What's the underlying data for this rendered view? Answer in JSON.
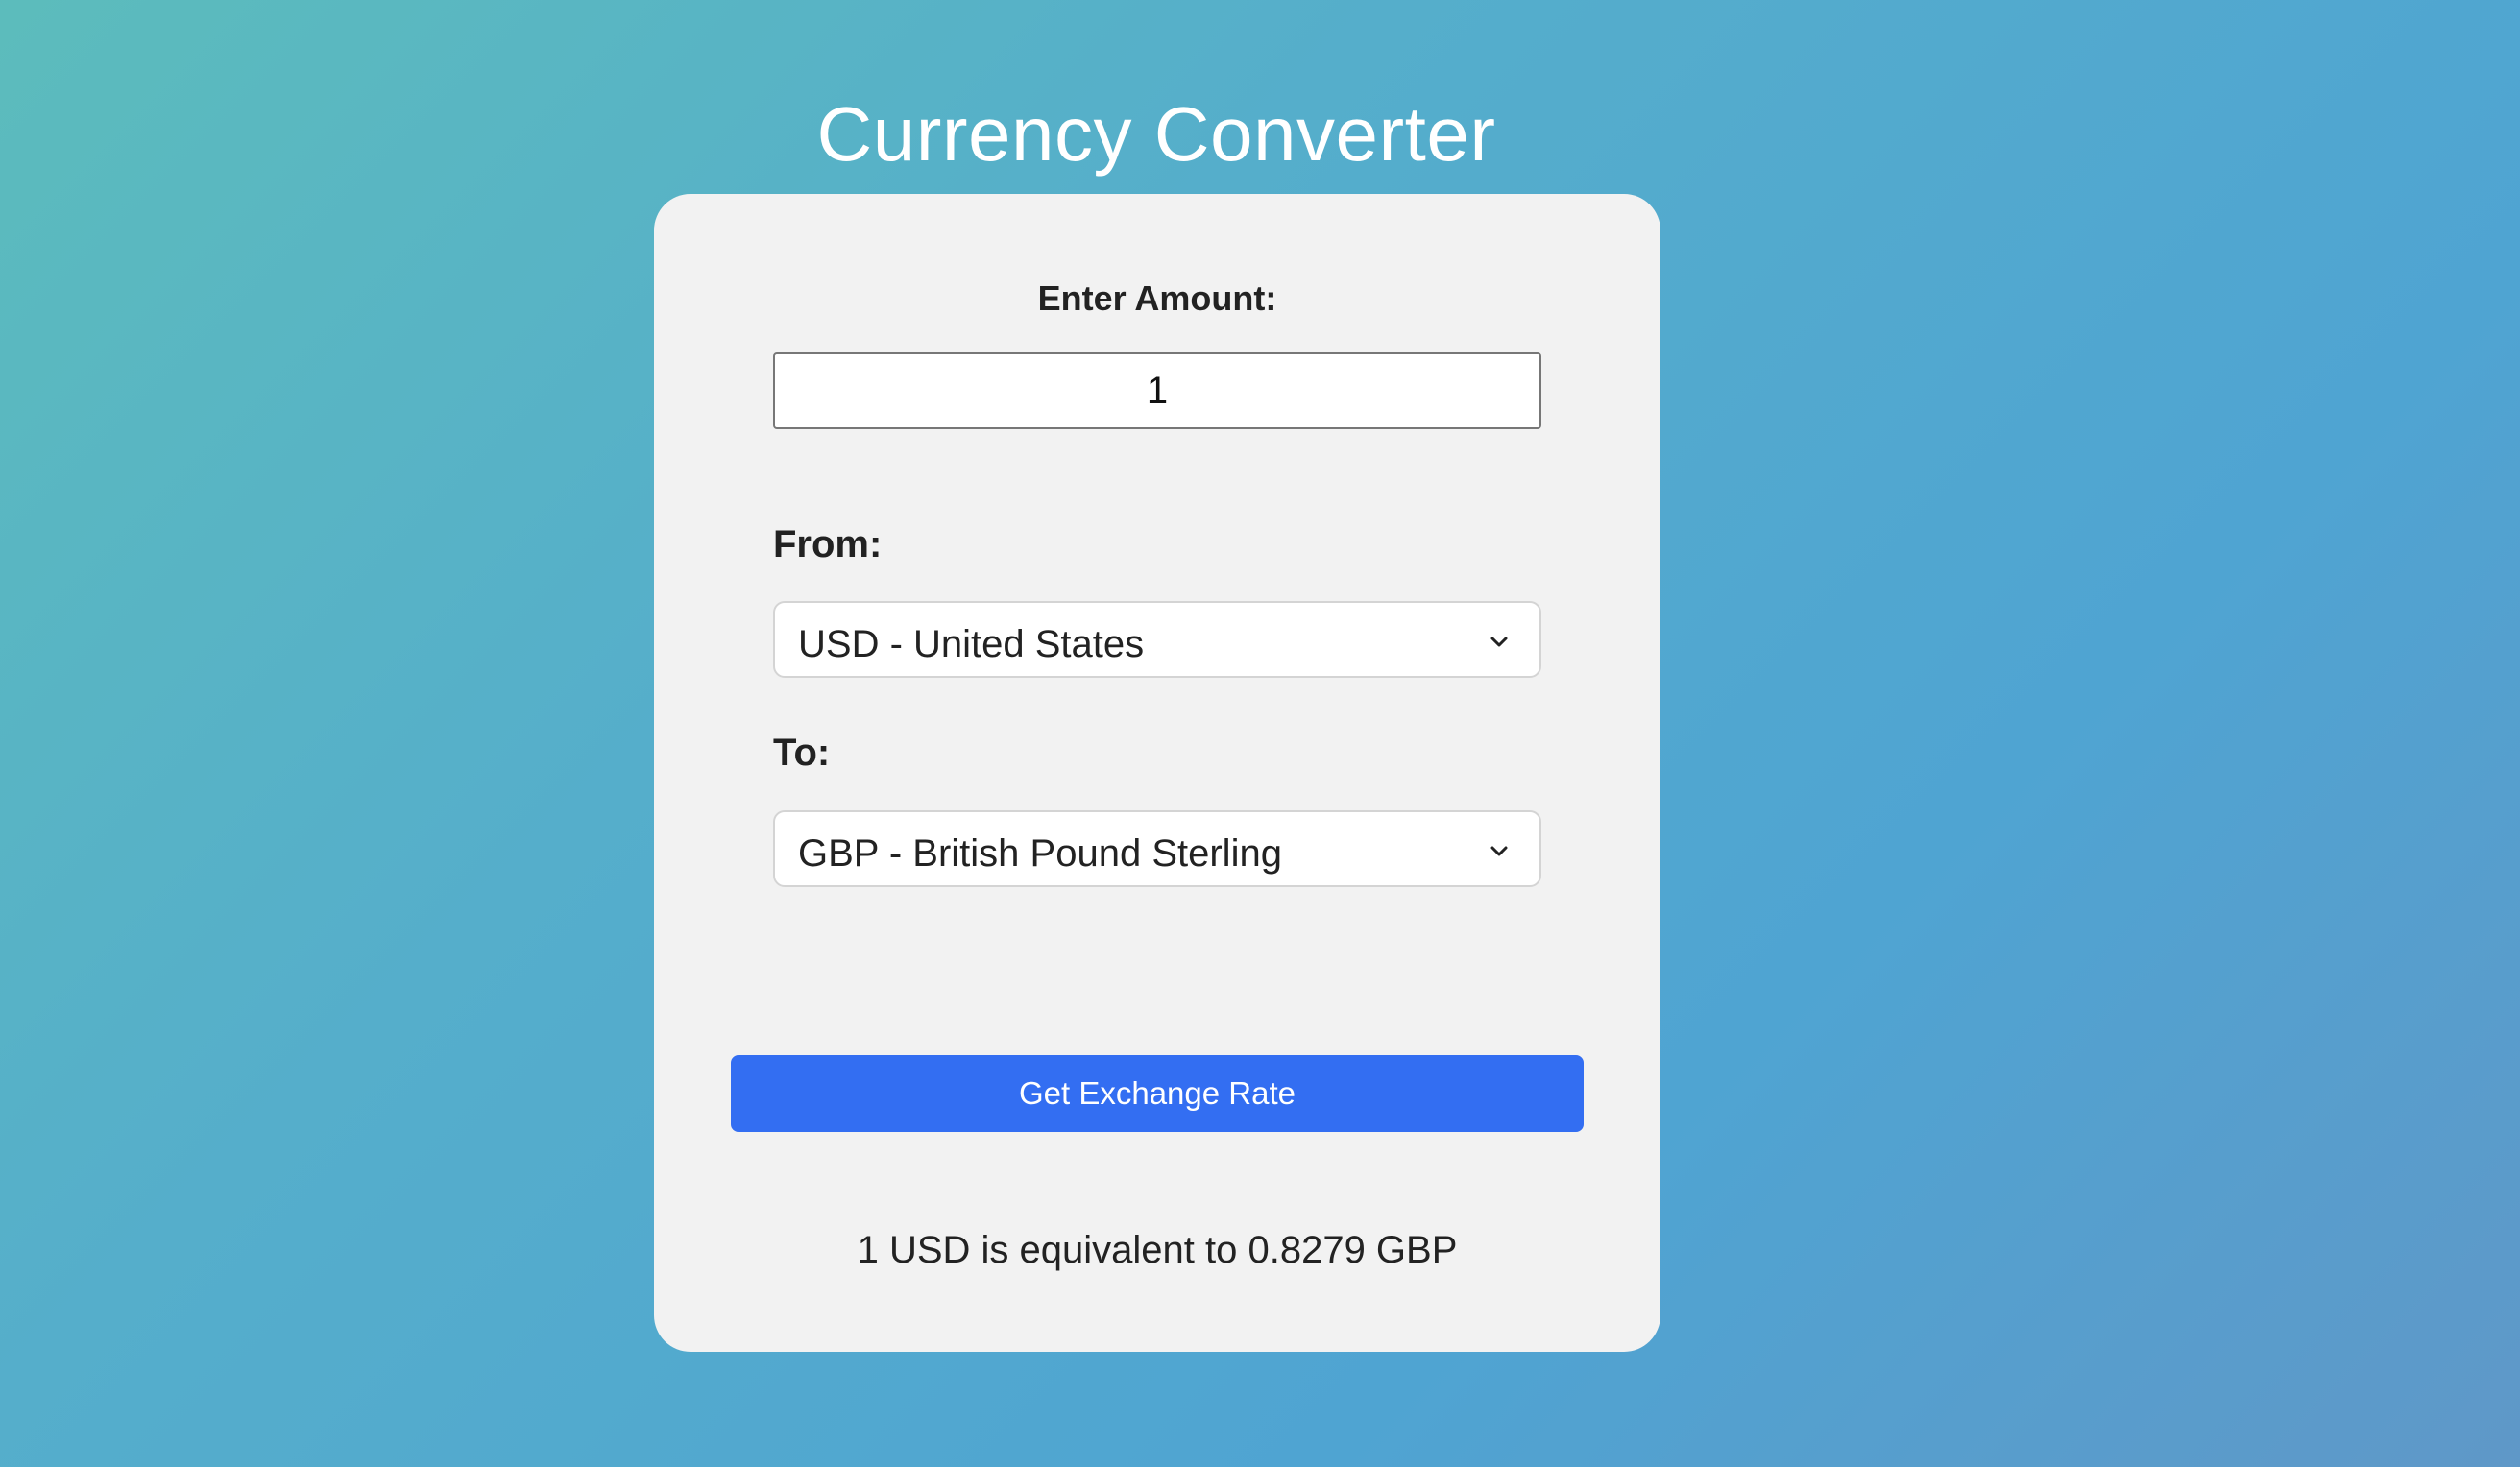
{
  "header": {
    "title": "Currency Converter"
  },
  "form": {
    "amount_label": "Enter Amount:",
    "amount_value": "1",
    "from_label": "From:",
    "from_selected": "USD - United States",
    "to_label": "To:",
    "to_selected": "GBP - British Pound Sterling",
    "button_label": "Get Exchange Rate"
  },
  "result": {
    "text": "1 USD is equivalent to 0.8279 GBP"
  },
  "colors": {
    "accent": "#336ef2",
    "card_background": "#f2f2f2",
    "title_text": "#ffffff"
  },
  "icons": {
    "dropdown": "chevron-down-icon"
  }
}
